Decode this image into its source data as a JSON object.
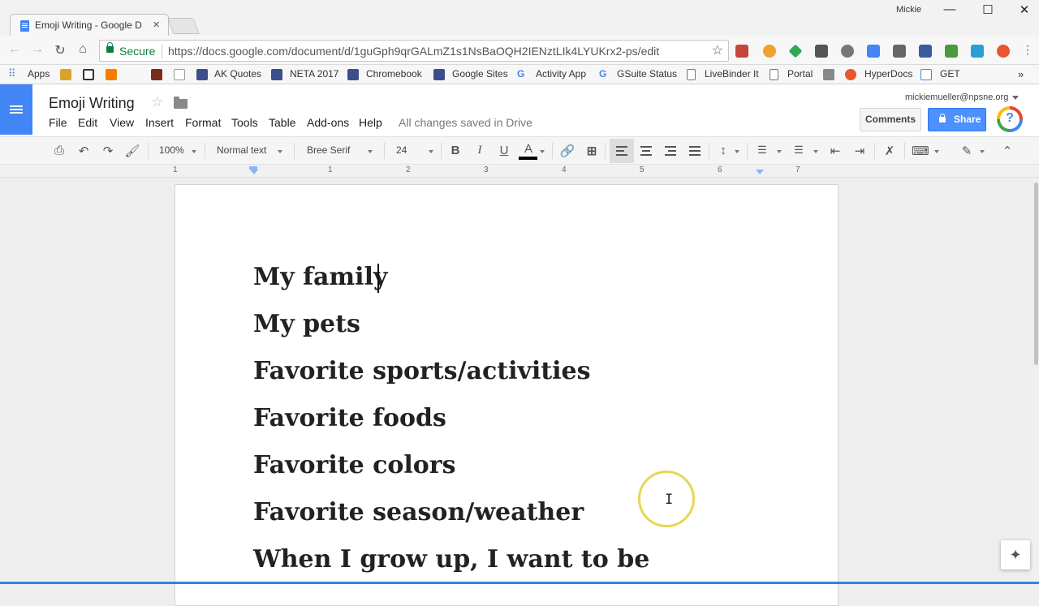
{
  "browser": {
    "tab_title": "Emoji Writing - Google D",
    "tab_close": "×",
    "profile_name": "Mickie",
    "window_controls": {
      "minimize": "—",
      "maximize": "☐",
      "close": "✕"
    },
    "secure_label": "Secure",
    "url": "https://docs.google.com/document/d/1guGph9qrGALmZ1s1NsBaOQH2IENztLIk4LYUKrx2-ps/edit",
    "bookmarks": [
      "Apps",
      "AK Quotes",
      "NETA 2017",
      "Chromebook",
      "Google Sites",
      "Activity App",
      "GSuite Status",
      "LiveBinder It",
      "Portal",
      "HyperDocs",
      "GET"
    ],
    "more_bookmarks": "»"
  },
  "docs": {
    "title": "Emoji Writing",
    "menus": [
      "File",
      "Edit",
      "View",
      "Insert",
      "Format",
      "Tools",
      "Table",
      "Add-ons",
      "Help"
    ],
    "save_status": "All changes saved in Drive",
    "account": "mickiemueller@npsne.org",
    "comments_label": "Comments",
    "share_label": "Share",
    "help_label": "?"
  },
  "toolbar": {
    "zoom": "100%",
    "style": "Normal text",
    "font": "Bree Serif",
    "font_size": "24",
    "bold": "B",
    "italic": "I",
    "underline": "U",
    "text_color": "A",
    "text_color_bar": "#000000"
  },
  "ruler": {
    "numbers": [
      "1",
      "1",
      "2",
      "3",
      "4",
      "5",
      "6",
      "7"
    ]
  },
  "document": {
    "lines": [
      "My family ",
      "My pets",
      "Favorite sports/activities",
      "Favorite foods",
      "Favorite colors",
      "Favorite season/weather",
      "When I grow up, I want to be"
    ]
  },
  "colors": {
    "docs_blue": "#4285f4",
    "share_blue": "#4d90fe",
    "secure_green": "#0b8043",
    "click_ring": "#e7d752"
  }
}
